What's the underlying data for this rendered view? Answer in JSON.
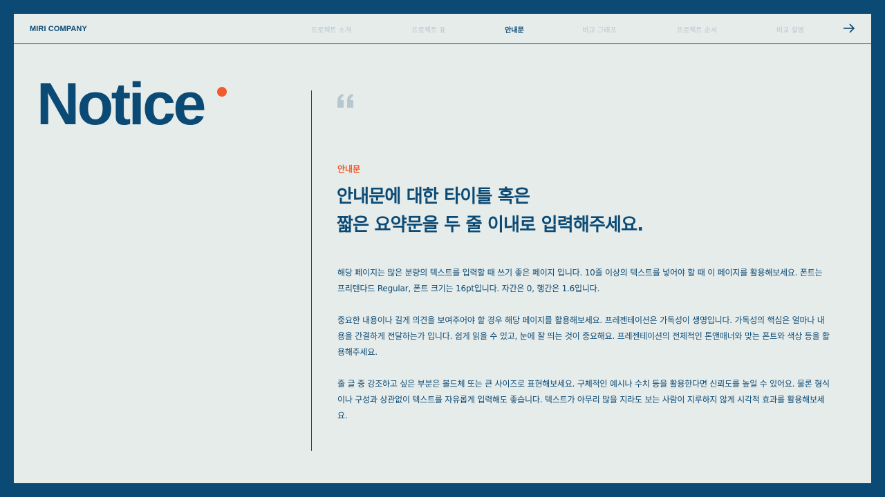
{
  "header": {
    "brand": "MIRI COMPANY",
    "nav": [
      {
        "label": "프로젝트 소개",
        "active": false
      },
      {
        "label": "프로젝트 표",
        "active": false
      },
      {
        "label": "안내문",
        "active": true
      },
      {
        "label": "비교 그래프",
        "active": false
      },
      {
        "label": "프로젝트 순서",
        "active": false
      },
      {
        "label": "비교 설명",
        "active": false
      }
    ],
    "next_icon": "arrow-right-icon"
  },
  "main": {
    "page_title": "Notice",
    "eyebrow": "안내문",
    "headline_line1": "안내문에 대한 타이틀 혹은",
    "headline_line2": "짧은 요약문을 두 줄 이내로 입력해주세요.",
    "paragraphs": [
      "해당 페이지는 많은 분량의 텍스트를 입력할 때 쓰기 좋은 페이지 입니다. 10줄 이상의 텍스트를 넣어야 할 때 이 페이지를 활용해보세요. 폰트는 프리텐다드 Regular, 폰트 크기는 16pt입니다. 자간은 0, 행간은 1.6입니다.",
      "중요한 내용이나 길게 의견을 보여주어야 할 경우 해당 페이지를 활용해보세요. 프레젠테이션은 가독성이 생명입니다. 가독성의 핵심은 얼마나 내용을 간결하게 전달하는가 입니다. 쉽게 읽을 수 있고, 눈에 잘 띄는 것이 중요해요. 프레젠테이션의 전체적인 톤앤매너와 맞는 폰트와 색상 등을 활용해주세요.",
      "줄 글 중 강조하고 싶은 부분은 볼드체 또는 큰 사이즈로 표현해보세요. 구체적인 예시나 수치 등을 활용한다면 신뢰도를 높일 수 있어요. 물론 형식이나 구성과 상관없이 텍스트를 자유롭게 입력해도 좋습니다. 텍스트가 아무리 많을 지라도 보는 사람이 지루하지 않게 시각적 효과를 활용해보세요."
    ]
  },
  "colors": {
    "brand_navy": "#0b4a75",
    "accent_orange": "#f15a2a",
    "background": "#e6ecea",
    "nav_inactive": "#b8c6cf",
    "quote_gray": "#b8c6cf"
  }
}
